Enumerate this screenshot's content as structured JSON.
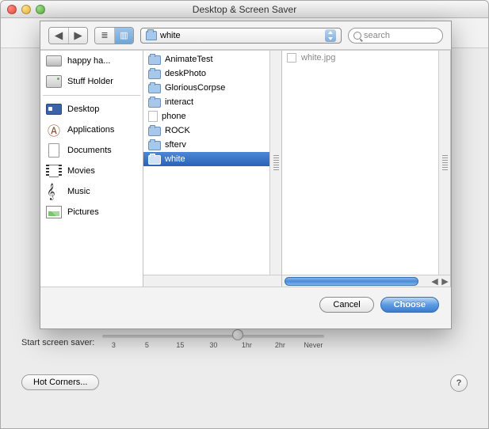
{
  "window": {
    "title": "Desktop & Screen Saver"
  },
  "bottom": {
    "slider_label": "Start screen saver:",
    "ticks": [
      "3",
      "5",
      "15",
      "30",
      "1hr",
      "2hr",
      "Never"
    ],
    "hot_corners_label": "Hot Corners...",
    "help_label": "?"
  },
  "sheet": {
    "path_label": "white",
    "search_placeholder": "search",
    "sidebar_devices": [
      {
        "label": "happy ha...",
        "icon": "disk"
      },
      {
        "label": "Stuff Holder",
        "icon": "hd"
      }
    ],
    "sidebar_places": [
      {
        "label": "Desktop",
        "icon": "desk"
      },
      {
        "label": "Applications",
        "icon": "app"
      },
      {
        "label": "Documents",
        "icon": "doc"
      },
      {
        "label": "Movies",
        "icon": "mov"
      },
      {
        "label": "Music",
        "icon": "mus"
      },
      {
        "label": "Pictures",
        "icon": "pic"
      }
    ],
    "column2": [
      {
        "label": "AnimateTest",
        "type": "folder"
      },
      {
        "label": "deskPhoto",
        "type": "folder"
      },
      {
        "label": "GloriousCorpse",
        "type": "folder"
      },
      {
        "label": "interact",
        "type": "folder"
      },
      {
        "label": "phone",
        "type": "doc"
      },
      {
        "label": "ROCK",
        "type": "folder"
      },
      {
        "label": "sfterv",
        "type": "folder"
      },
      {
        "label": "white",
        "type": "folder",
        "selected": true
      }
    ],
    "column3": [
      {
        "label": "white.jpg"
      }
    ],
    "cancel_label": "Cancel",
    "choose_label": "Choose"
  }
}
